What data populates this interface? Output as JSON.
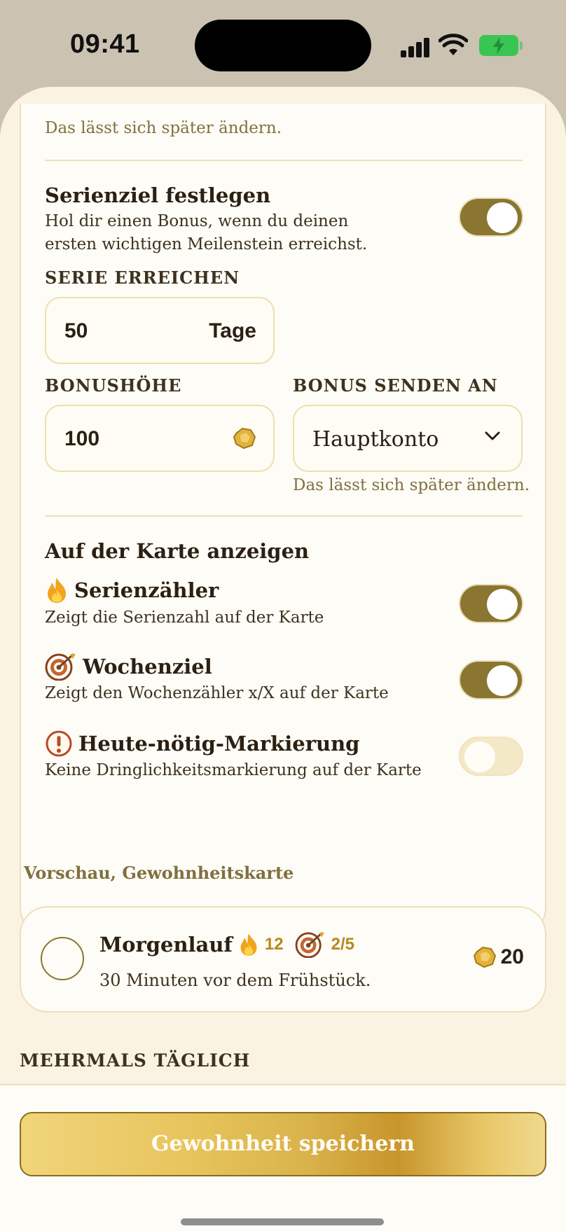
{
  "status": {
    "time": "09:41"
  },
  "top_note": "Das lässt sich später ändern.",
  "goal": {
    "title": "Serienziel festlegen",
    "description": "Hol dir einen Bonus, wenn du deinen ersten wichtigen Meilenstein erreichst.",
    "enabled": true
  },
  "streak": {
    "label": "SERIE ERREICHEN",
    "value": "50",
    "unit": "Tage"
  },
  "bonus": {
    "label": "BONUSHÖHE",
    "value": "100",
    "send_label": "BONUS SENDEN AN",
    "send_value": "Hauptkonto",
    "note": "Das lässt sich später ändern."
  },
  "display": {
    "title": "Auf der Karte anzeigen",
    "options": [
      {
        "title": "Serienzähler",
        "description": "Zeigt die Serienzahl auf der Karte",
        "icon": "fire-icon",
        "enabled": true
      },
      {
        "title": "Wochenziel",
        "description": "Zeigt den Wochenzähler x/X auf der Karte",
        "icon": "target-icon",
        "enabled": true
      },
      {
        "title": "Heute-nötig-Markierung",
        "description": "Keine Dringlichkeitsmarkierung auf der Karte",
        "icon": "alert-icon",
        "enabled": false
      }
    ],
    "preview_label": "Vorschau, Gewohnheitskarte"
  },
  "preview": {
    "name": "Morgenlauf",
    "streak": "12",
    "weekly": "2/5",
    "subtitle": "30 Minuten vor dem Frühstück.",
    "reward": "20"
  },
  "section_label": "MEHRMALS TÄGLICH",
  "save_button": "Gewohnheit speichern",
  "colors": {
    "accent": "#8a7631",
    "background": "#fbf3e2",
    "gold": "#d9b24a",
    "battery": "#39c552"
  }
}
